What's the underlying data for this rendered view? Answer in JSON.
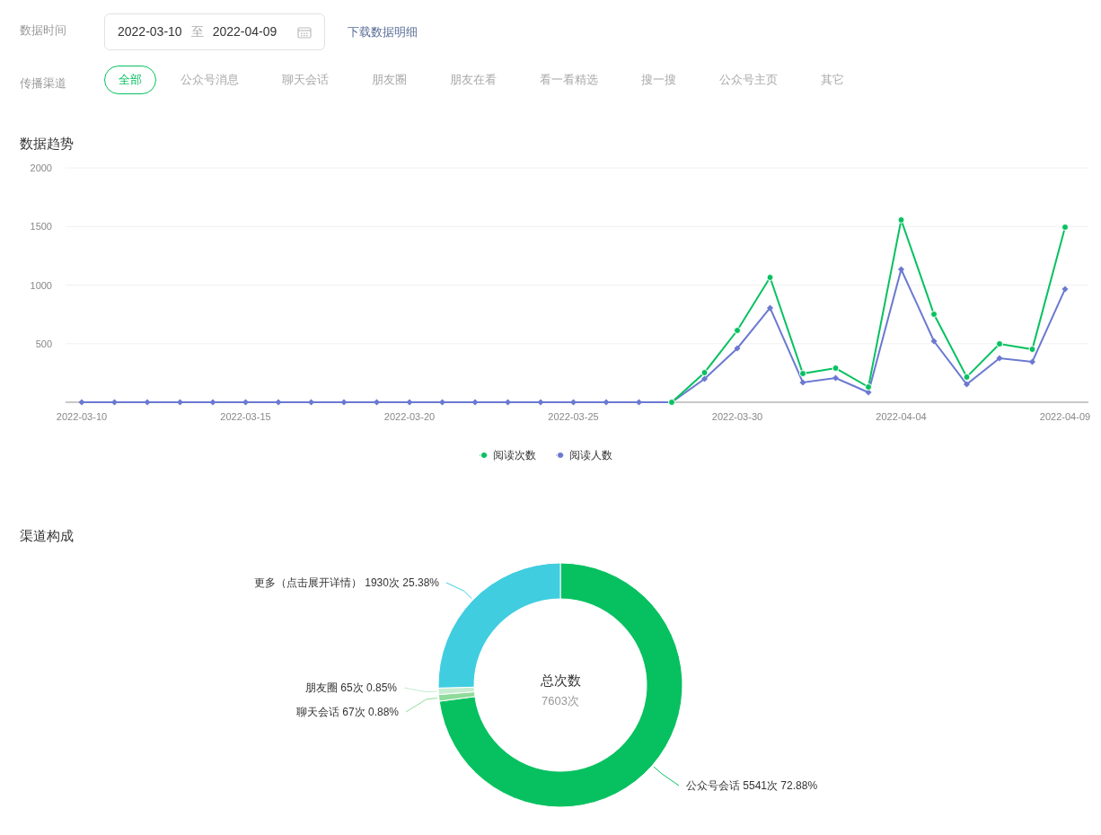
{
  "filters": {
    "date_label": "数据时间",
    "date_range": {
      "start": "2022-03-10",
      "separator": "至",
      "end": "2022-04-09"
    },
    "download_link": "下载数据明细",
    "channel_label": "传播渠道",
    "channels": [
      {
        "label": "全部",
        "selected": true
      },
      {
        "label": "公众号消息",
        "selected": false
      },
      {
        "label": "聊天会话",
        "selected": false
      },
      {
        "label": "朋友圈",
        "selected": false
      },
      {
        "label": "朋友在看",
        "selected": false
      },
      {
        "label": "看一看精选",
        "selected": false
      },
      {
        "label": "搜一搜",
        "selected": false
      },
      {
        "label": "公众号主页",
        "selected": false
      },
      {
        "label": "其它",
        "selected": false
      }
    ]
  },
  "trend": {
    "title": "数据趋势",
    "chart_data": {
      "type": "line",
      "grid": true,
      "categories": [
        "2022-03-10",
        null,
        null,
        null,
        null,
        "2022-03-15",
        null,
        null,
        null,
        null,
        "2022-03-20",
        null,
        null,
        null,
        null,
        "2022-03-25",
        null,
        null,
        null,
        null,
        "2022-03-30",
        null,
        null,
        null,
        null,
        "2022-04-04",
        null,
        null,
        null,
        null,
        "2022-04-09"
      ],
      "series": [
        {
          "name": "阅读次数",
          "color": "#07c160",
          "marker": "circle",
          "values": [
            null,
            null,
            null,
            null,
            null,
            null,
            null,
            null,
            null,
            null,
            null,
            null,
            null,
            null,
            null,
            null,
            null,
            null,
            0,
            253,
            613,
            1065,
            245,
            291,
            130,
            1556,
            751,
            215,
            498,
            452,
            1494
          ]
        },
        {
          "name": "阅读人数",
          "color": "#6b79d0",
          "marker": "diamond",
          "values": [
            0,
            0,
            0,
            0,
            0,
            0,
            0,
            0,
            0,
            0,
            0,
            0,
            0,
            0,
            0,
            0,
            0,
            0,
            0,
            199,
            460,
            805,
            169,
            207,
            84,
            1134,
            521,
            153,
            375,
            345,
            966
          ]
        }
      ],
      "ylim": [
        0,
        2000
      ],
      "yticks": [
        500,
        1000,
        1500,
        2000
      ]
    }
  },
  "composition": {
    "title": "渠道构成",
    "center_title": "总次数",
    "center_value": "7603次",
    "chart_data": {
      "type": "donut",
      "categories": [
        "公众号会话",
        "聊天会话",
        "朋友圈",
        "更多（点击展开详情）"
      ],
      "values": [
        5541,
        67,
        65,
        1930
      ],
      "colors": [
        "#07c160",
        "#8fdb9a",
        "#c6ecd0",
        "#40cde0"
      ],
      "value_labels": [
        "5541次 72.88%",
        "67次 0.88%",
        "65次 0.85%",
        "1930次 25.38%"
      ]
    }
  }
}
